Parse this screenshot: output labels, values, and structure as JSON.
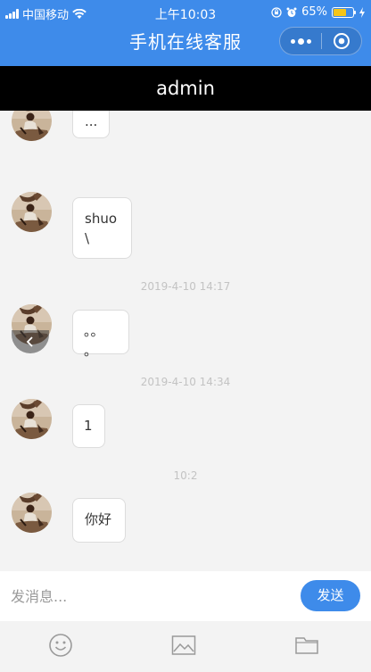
{
  "status_bar": {
    "carrier": "中国移动",
    "time": "上午10:03",
    "battery_percent": "65%",
    "battery_level": 0.65
  },
  "nav": {
    "title": "手机在线客服"
  },
  "chat_header": {
    "title": "admin"
  },
  "messages": [
    {
      "text": "..."
    },
    {
      "text": "shuo\n\\"
    },
    {
      "text": "。。 。"
    },
    {
      "text": "1"
    },
    {
      "text": "你好"
    }
  ],
  "timestamps": [
    "2019-4-10 14:17",
    "2019-4-10 14:34",
    "10:2"
  ],
  "input": {
    "placeholder": "发消息...",
    "send_label": "发送"
  },
  "toolbar": {
    "icons": [
      "emoji-icon",
      "image-icon",
      "folder-icon"
    ]
  },
  "colors": {
    "accent": "#3e8bea",
    "header_black": "#000000",
    "background": "#f3f3f3"
  }
}
